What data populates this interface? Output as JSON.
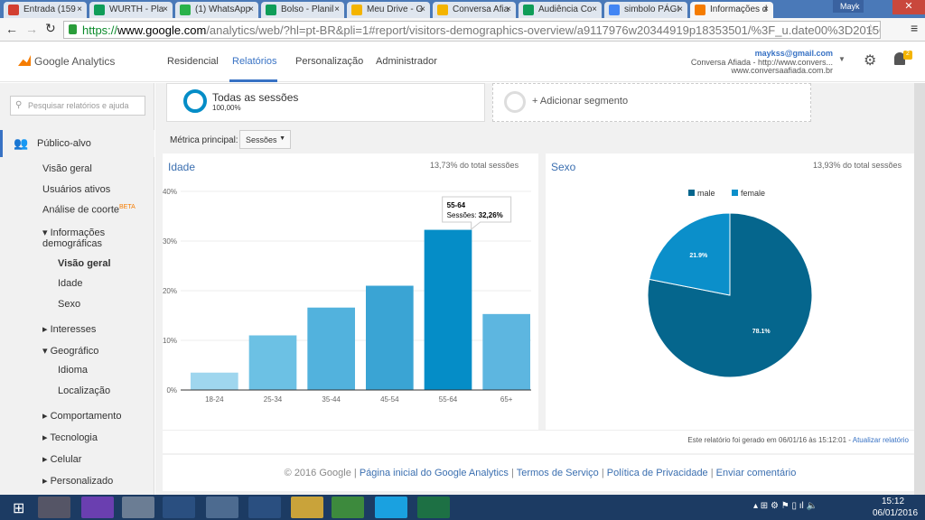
{
  "browser": {
    "tabs": [
      {
        "label": "Entrada (159",
        "color": "#d23f31"
      },
      {
        "label": "WURTH - Pla",
        "color": "#0f9d58"
      },
      {
        "label": "(1) WhatsApp",
        "color": "#2ab24a"
      },
      {
        "label": "Bolso - Planil",
        "color": "#0f9d58"
      },
      {
        "label": "Meu Drive - G",
        "color": "#f4b400"
      },
      {
        "label": "Conversa Afia",
        "color": "#f4b400"
      },
      {
        "label": "Audiência Co",
        "color": "#0f9d58"
      },
      {
        "label": "simbolo PÁGI",
        "color": "#4285f4"
      },
      {
        "label": "Informações d",
        "color": "#f57c00"
      }
    ],
    "user": "Mayk",
    "url_scheme": "https://",
    "url_host": "www.google.com",
    "url_path": "/analytics/web/?hl=pt-BR&pli=1#report/visitors-demographics-overview/a9117976w20344919p18353501/%3F_u.date00%3D20150801%26"
  },
  "header": {
    "logo": "Google Analytics",
    "nav": [
      "Residencial",
      "Relatórios",
      "Personalização",
      "Administrador"
    ],
    "active_nav": 1,
    "account_email": "maykss@gmail.com",
    "account_name": "Conversa Afiada - http://www.convers...",
    "account_site": "www.conversaafiada.com.br",
    "notification_count": "2"
  },
  "sidebar": {
    "search_placeholder": "Pesquisar relatórios e ajuda",
    "section": "Público-alvo",
    "items": [
      {
        "label": "Visão geral"
      },
      {
        "label": "Usuários ativos"
      },
      {
        "label": "Análise de coorte",
        "badge": "BETA"
      },
      {
        "label": "Informações demográficas",
        "expanded": true
      },
      {
        "label": "Visão geral",
        "active": true
      },
      {
        "label": "Idade"
      },
      {
        "label": "Sexo"
      },
      {
        "label": "Interesses"
      },
      {
        "label": "Geográfico",
        "expanded": true
      },
      {
        "label": "Idioma"
      },
      {
        "label": "Localização"
      },
      {
        "label": "Comportamento"
      },
      {
        "label": "Tecnologia"
      },
      {
        "label": "Celular"
      },
      {
        "label": "Personalizado"
      }
    ]
  },
  "segments": {
    "current": "Todas as sessões",
    "current_pct": "100,00%",
    "add": "+ Adicionar segmento"
  },
  "metric": {
    "label": "Métrica principal:",
    "value": "Sessões"
  },
  "chart_data": [
    {
      "type": "bar",
      "title": "Idade",
      "subtitle": "13,73% do total sessões",
      "categories": [
        "18-24",
        "25-34",
        "35-44",
        "45-54",
        "55-64",
        "65+"
      ],
      "values": [
        3.5,
        11.0,
        16.6,
        21.0,
        32.26,
        15.3
      ],
      "colors": [
        "#9fd6ee",
        "#6cc1e4",
        "#52b2dd",
        "#3aa4d4",
        "#058dc7",
        "#5db6e0"
      ],
      "ylim": [
        0,
        40
      ],
      "yticks": [
        "0%",
        "10%",
        "20%",
        "30%",
        "40%"
      ],
      "tooltip": {
        "category": "55-64",
        "text": "Sessões:",
        "value": "32,26%"
      },
      "grid": true
    },
    {
      "type": "pie",
      "title": "Sexo",
      "subtitle": "13,93% do total sessões",
      "slices": [
        {
          "name": "male",
          "value": 78.1,
          "label": "78.1%",
          "color": "#05668d"
        },
        {
          "name": "female",
          "value": 21.9,
          "label": "21.9%",
          "color": "#0b8fca"
        }
      ],
      "legend": "top"
    }
  ],
  "footer": {
    "generated": "Este relatório foi gerado em 06/01/16 às 15:12:01 - ",
    "refresh": "Atualizar relatório",
    "copyright": "© 2016 Google",
    "links": [
      "Página inicial do Google Analytics",
      "Termos de Serviço",
      "Política de Privacidade",
      "Enviar comentário"
    ]
  },
  "taskbar": {
    "time": "15:12",
    "date": "06/01/2016"
  }
}
